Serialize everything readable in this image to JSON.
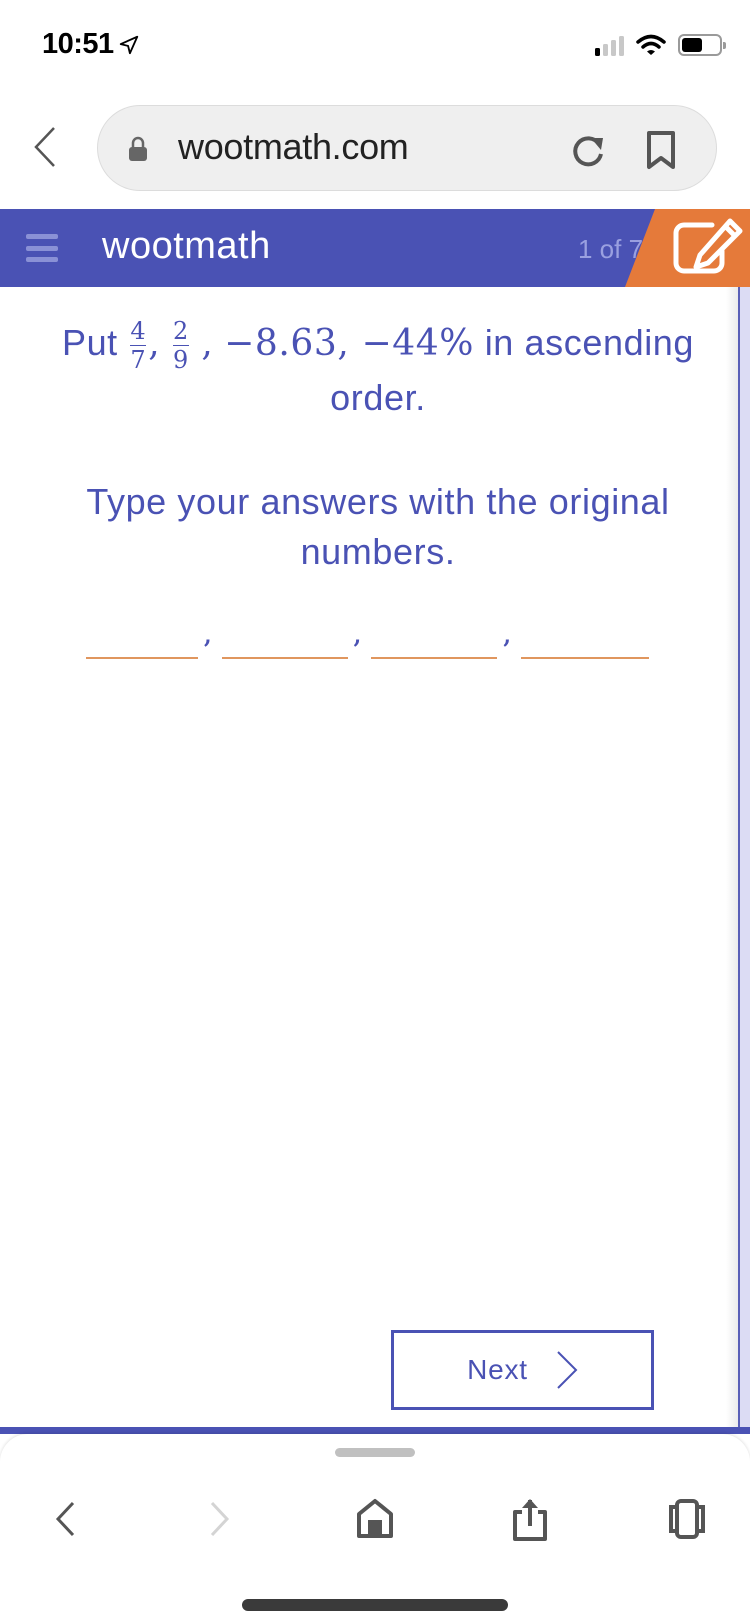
{
  "status_bar": {
    "time": "10:51",
    "icons": [
      "location-arrow-icon",
      "cellular-signal-icon",
      "wifi-icon",
      "battery-icon"
    ],
    "signal_bars_active": 1,
    "signal_bars_total": 4,
    "battery_level": 0.45
  },
  "browser": {
    "url": "wootmath.com",
    "icons": [
      "back-chevron-icon",
      "lock-icon",
      "reload-icon",
      "bookmark-icon"
    ]
  },
  "app_header": {
    "brand": "wootmath",
    "progress_text": "1 of 7",
    "progress": {
      "current": 1,
      "total": 7
    },
    "menu_icon": "hamburger-icon",
    "edit_icon": "pencil-edit-icon",
    "colors": {
      "primary": "#4a52b4",
      "accent": "#e57a3a"
    }
  },
  "question": {
    "prefix": "Put",
    "fractions": [
      {
        "numerator": "4",
        "denominator": "7"
      },
      {
        "numerator": "2",
        "denominator": "9"
      }
    ],
    "sep1": ",",
    "sep2": ",",
    "values_text": "−8.63, −44%",
    "suffix": "in ascending order.",
    "instruction": "Type your answers with the original numbers."
  },
  "answers": {
    "count": 4,
    "values": [
      "",
      "",
      "",
      ""
    ],
    "separator": ","
  },
  "next_button": {
    "label": "Next",
    "icon": "chevron-right-icon"
  },
  "bottom_toolbar": {
    "items": [
      {
        "name": "back",
        "icon": "chevron-left-icon",
        "enabled": true
      },
      {
        "name": "forward",
        "icon": "chevron-right-icon",
        "enabled": false
      },
      {
        "name": "home",
        "icon": "home-icon",
        "enabled": true
      },
      {
        "name": "share",
        "icon": "share-icon",
        "enabled": true
      },
      {
        "name": "tabs",
        "icon": "tabs-icon",
        "enabled": true
      }
    ]
  }
}
